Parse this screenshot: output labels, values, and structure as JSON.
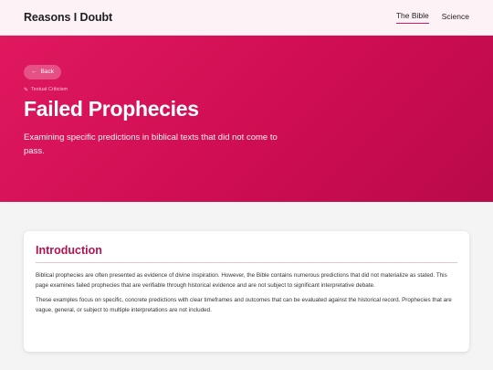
{
  "header": {
    "brand": "Reasons I Doubt",
    "nav": [
      {
        "label": "The Bible",
        "active": true
      },
      {
        "label": "Science",
        "active": false
      }
    ]
  },
  "hero": {
    "back_label": "Back",
    "back_icon": "arrow-left-icon",
    "category_icon": "textual-criticism-icon",
    "category_label": "Textual Criticism",
    "title": "Failed Prophecies",
    "subtitle": "Examining specific predictions in biblical texts that did not come to pass."
  },
  "intro": {
    "title": "Introduction",
    "paragraphs": [
      "Biblical prophecies are often presented as evidence of divine inspiration. However, the Bible contains numerous predictions that did not materialize as stated. This page examines failed prophecies that are verifiable through historical evidence and are not subject to significant interpretative debate.",
      "These examples focus on specific, concrete predictions with clear timeframes and outcomes that can be evaluated against the historical record. Prophecies that are vague, general, or subject to multiple interpretations are not included."
    ]
  },
  "colors": {
    "accent": "#d81b60",
    "hero_start": "#e0185f",
    "hero_end": "#b90a49",
    "card_title": "#b5134f"
  }
}
